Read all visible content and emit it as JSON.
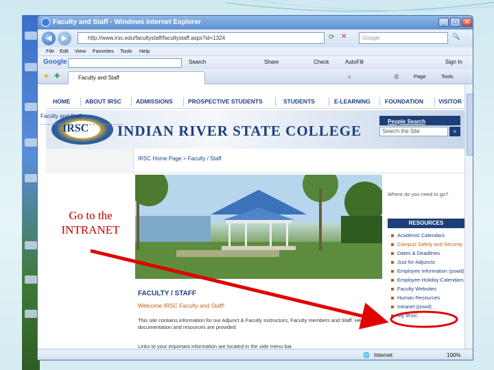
{
  "window": {
    "title": "Faculty and Staff - Windows Internet Explorer",
    "minimize_label": "_",
    "maximize_label": "□",
    "close_label": "✕"
  },
  "addressbar": {
    "back_label": "◀",
    "forward_label": "▶",
    "url": "http://www.irsc.edu/facultystaff/facultystaff.aspx?id=1324",
    "search_placeholder": "Google",
    "search_button_label": "🔍"
  },
  "menu": {
    "items": [
      "File",
      "Edit",
      "View",
      "Favorites",
      "Tools",
      "Help"
    ]
  },
  "google_toolbar": {
    "logo": "Google",
    "search_label": "Search",
    "share_label": "Share",
    "check_label": "Check",
    "autofill_label": "AutoFill",
    "signin_label": "Sign In"
  },
  "tabs": {
    "active_tab": "Faculty and Staff",
    "page_label": "Page",
    "tools_label": "Tools"
  },
  "site_nav": {
    "items": [
      "HOME",
      "ABOUT IRSC",
      "ADMISSIONS",
      "PROSPECTIVE STUDENTS",
      "STUDENTS",
      "E-LEARNING",
      "FOUNDATION",
      "VISITOR"
    ]
  },
  "banner": {
    "crest_text": "IRSC",
    "college_name": "INDIAN RIVER STATE COLLEGE",
    "people_search": "People Search",
    "site_search_placeholder": "Search the Site",
    "go_label": "»"
  },
  "content": {
    "breadcrumb": "IRSC Home Page > Faculty / Staff",
    "left_label": "Faculty and Staff",
    "heading": "FACULTY / STAFF",
    "welcome": "Welcome IRSC Faculty and Staff!",
    "body1": "This site contains information for our Adjunct & Faculty Instructors, Faculty members and Staff. Helpful documentation and resources are provided.",
    "body2": "Links to your important information are located in the side menu bar."
  },
  "sidebar": {
    "where_label": "Where do you need to go?",
    "resources_heading": "RESOURCES",
    "items": [
      {
        "label": "Academic Calendars"
      },
      {
        "label": "Campus Safety and Security"
      },
      {
        "label": "Dates & Deadlines"
      },
      {
        "label": "Just for Adjuncts"
      },
      {
        "label": "Employee Information (pswd)"
      },
      {
        "label": "Employee Holiday Calendars"
      },
      {
        "label": "Faculty Websites"
      },
      {
        "label": "Human Resources"
      },
      {
        "label": "Intranet (pswd)"
      },
      {
        "label": "My IRSC"
      }
    ]
  },
  "statusbar": {
    "zone": "Internet",
    "zoom": "100%"
  },
  "annotation": {
    "text": "Go to the INTRANET",
    "color": "#cc0000"
  },
  "colors": {
    "nav_text": "#1a3f7d",
    "accent_orange": "#c35a10",
    "resources_header": "#1d3f78"
  }
}
